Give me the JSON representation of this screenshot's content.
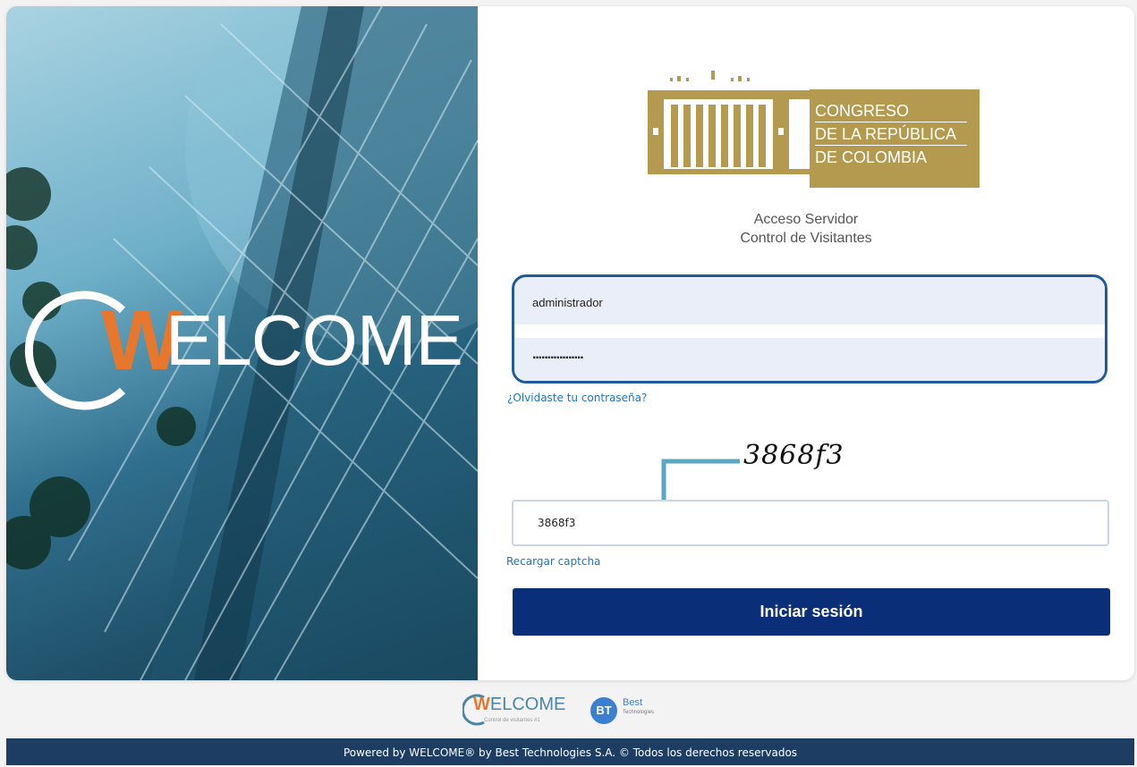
{
  "hero": {
    "brand_w": "W",
    "brand_rest": "ELCOME"
  },
  "logo": {
    "line1": "CONGRESO",
    "line2": "DE LA REPÚBLICA",
    "line3": "DE COLOMBIA",
    "top_marks": ".v. \u0002 .v."
  },
  "header": {
    "title1": "Acceso Servidor",
    "title2": "Control de Visitantes"
  },
  "form": {
    "username_value": "administrador",
    "password_value": "·················",
    "forgot_link": "¿Olvidaste tu contraseña?",
    "captcha_text": "3868f3",
    "captcha_value": "3868f3",
    "reload_captcha": "Recargar captcha",
    "submit_label": "Iniciar sesión"
  },
  "footer": {
    "welcome_w": "W",
    "welcome_rest": "ELCOME",
    "welcome_tagline": "Control de visitantes #1",
    "best_badge": "BT",
    "best_name": "Best",
    "best_sub": "Technologies",
    "powered_text": "Powered by WELCOME® by Best Technologies S.A. © Todos los derechos reservados"
  },
  "colors": {
    "accent": "#0b2e78",
    "highlight_border": "#1f5a9c",
    "gold": "#b39a4f",
    "link": "#1c75b8",
    "welcome_orange": "#e8772e"
  }
}
